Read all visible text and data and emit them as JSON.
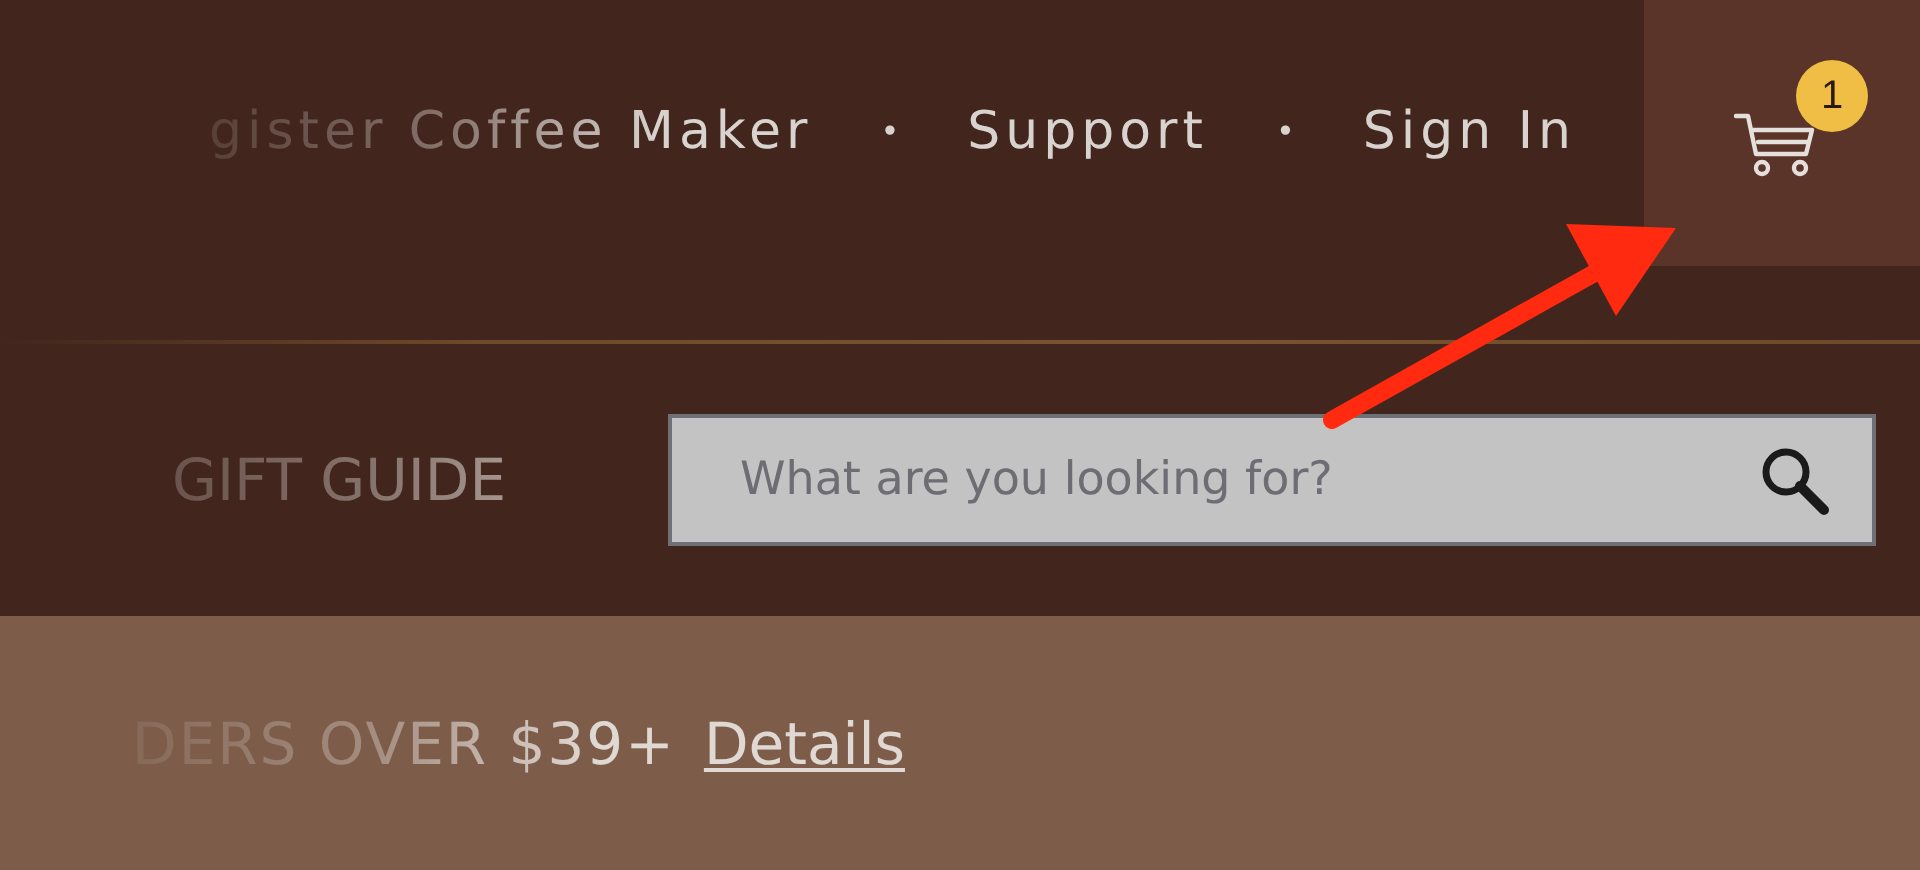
{
  "nav": [
    {
      "kind": "link",
      "text": "gister Coffee Maker"
    },
    {
      "kind": "separator",
      "text": "•"
    },
    {
      "kind": "link",
      "text": "Support"
    },
    {
      "kind": "separator",
      "text": "•"
    },
    {
      "kind": "link",
      "text": "Sign In"
    }
  ],
  "cart": {
    "badge": "1"
  },
  "menu": {
    "label": "GIFT GUIDE"
  },
  "search": {
    "placeholder": "What are you looking for?"
  },
  "promo": {
    "text": "DERS OVER $39+",
    "link": "Details"
  }
}
